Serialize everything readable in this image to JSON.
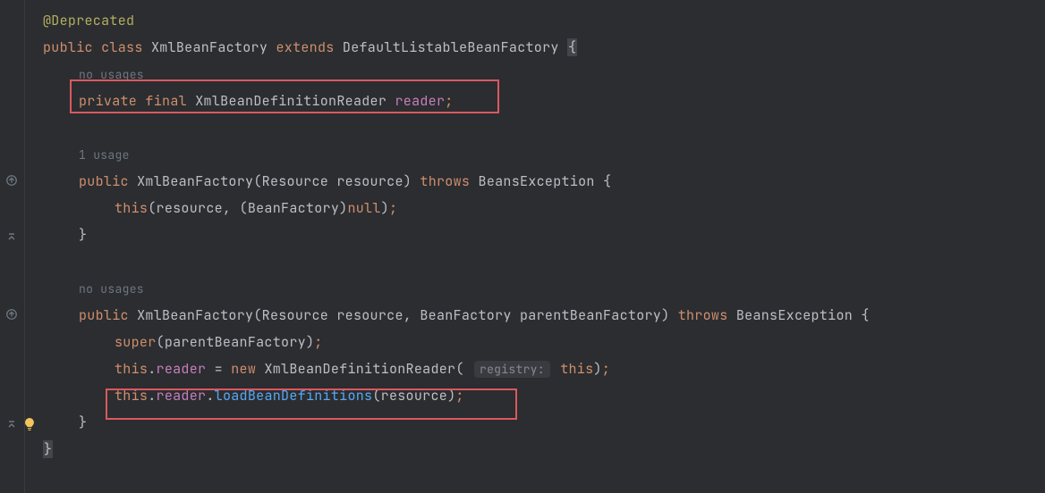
{
  "code": {
    "annotation": "@Deprecated",
    "public": "public",
    "class": "class",
    "className": "XmlBeanFactory",
    "extends": "extends",
    "superClass": "DefaultListableBeanFactory",
    "openBrace": "{",
    "closeBrace": "}",
    "hints": {
      "noUsages": "no usages",
      "oneUsage": "1 usage"
    },
    "field": {
      "private": "private",
      "final": "final",
      "type": "XmlBeanDefinitionReader",
      "name": "reader",
      "semi": ";"
    },
    "ctor1": {
      "public": "public",
      "name": "XmlBeanFactory",
      "paramType": "Resource",
      "paramName": "resource",
      "throws": "throws",
      "exception": "BeansException",
      "openBrace": "{",
      "body": {
        "this": "this",
        "openParen": "(",
        "arg1": "resource",
        "comma": ", ",
        "cast": "(BeanFactory)",
        "nullKw": "null",
        "closeParen": ")",
        "semi": ";"
      },
      "closeBrace": "}"
    },
    "ctor2": {
      "public": "public",
      "name": "XmlBeanFactory",
      "param1Type": "Resource",
      "param1Name": "resource",
      "param2Type": "BeanFactory",
      "param2Name": "parentBeanFactory",
      "throws": "throws",
      "exception": "BeansException",
      "openBrace": "{",
      "line1": {
        "super": "super",
        "openParen": "(",
        "arg": "parentBeanFactory",
        "closeParen": ")",
        "semi": ";"
      },
      "line2": {
        "this": "this",
        "dot": ".",
        "reader": "reader",
        "eq": " = ",
        "new": "new",
        "type": "XmlBeanDefinitionReader",
        "openParen": "(",
        "hint": "registry:",
        "arg": "this",
        "closeParen": ")",
        "semi": ";"
      },
      "line3": {
        "this": "this",
        "dot": ".",
        "reader": "reader",
        "dot2": ".",
        "method": "loadBeanDefinitions",
        "openParen": "(",
        "arg": "resource",
        "closeParen": ")",
        "semi": ";"
      },
      "closeBrace": "}"
    }
  }
}
